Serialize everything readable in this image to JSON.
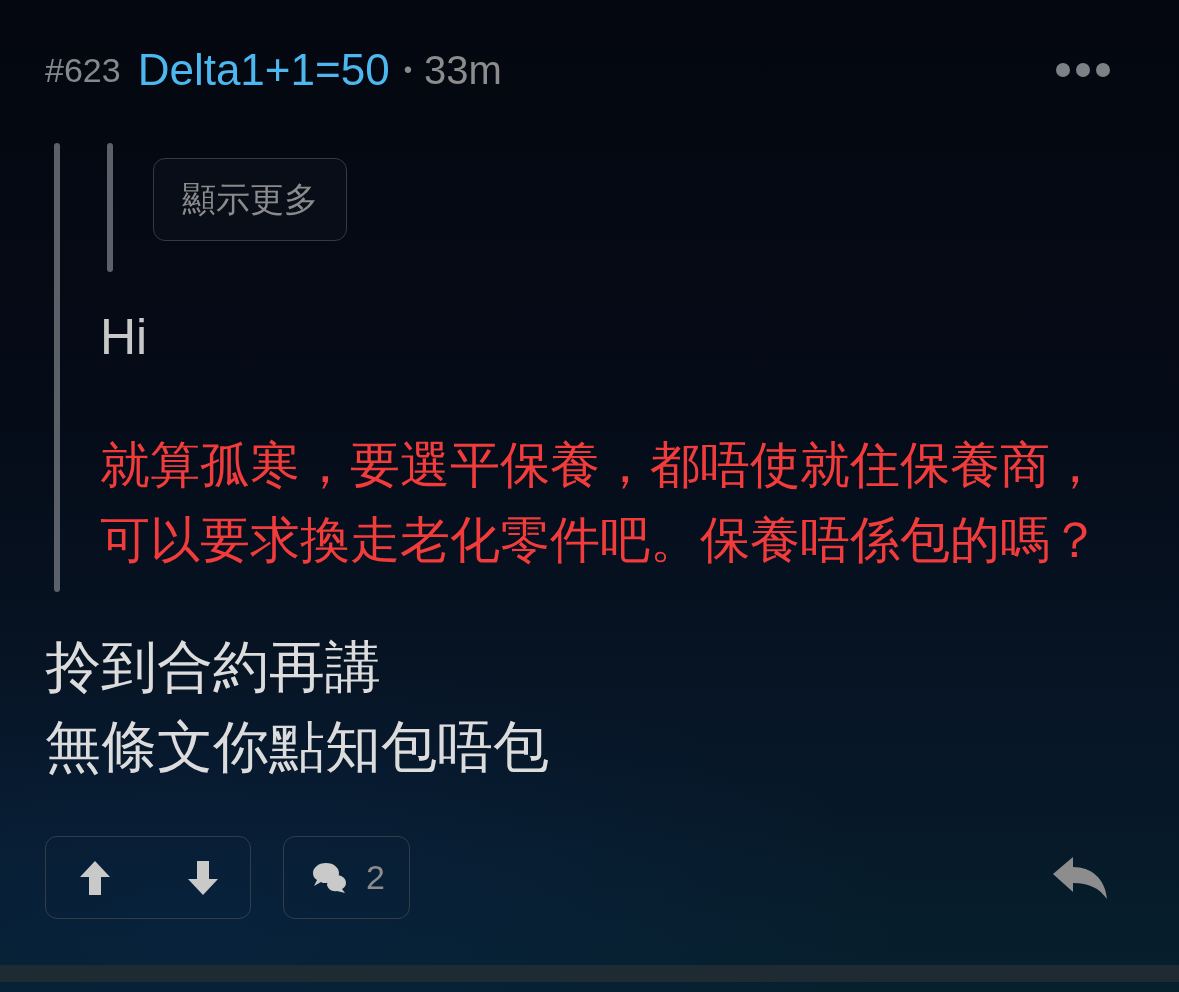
{
  "post": {
    "number": "#623",
    "username": "Delta1+1=50",
    "separator": "•",
    "time": "33m"
  },
  "quote": {
    "nested_quote": {
      "show_more_button": "顯示更多"
    },
    "paragraphs": [
      {
        "color": "#c8c8c8",
        "lines": [
          "Hi"
        ]
      },
      {
        "color": "#f23b3b",
        "lines": [
          "就算孤寒，要選平保養，都唔使就住保養商，",
          "可以要求換走老化零件吧。保養唔係包的嗎？"
        ]
      }
    ]
  },
  "body": {
    "lines": [
      "拎到合約再講",
      "無條文你點知包唔包"
    ]
  },
  "actions": {
    "comment_count": "2"
  }
}
